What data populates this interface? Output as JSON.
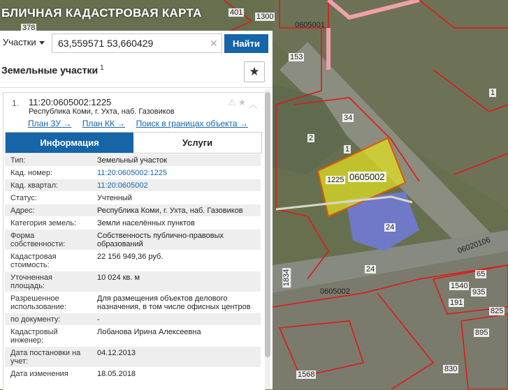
{
  "app": {
    "title": "ПУБЛИЧНАЯ КАДАСТРОВАЯ КАРТА",
    "visible_title": "БЛИЧНАЯ КАДАСТРОВАЯ КАРТА"
  },
  "search": {
    "type_label": "Участки",
    "query": "63,559571 53,660429",
    "clear": "✕",
    "button": "Найти"
  },
  "panel": {
    "title": "Земельные участки",
    "count_sup": "1",
    "star": "★"
  },
  "card": {
    "index": "1.",
    "cad_number": "11:20:0605002:1225",
    "address": "Республика Коми, г. Ухта, наб. Газовиков",
    "actions": [
      "⚠",
      "★",
      "︿"
    ],
    "links": [
      "План ЗУ →",
      "План КК →",
      "Поиск в границах объекта →"
    ],
    "tabs": [
      "Информация",
      "Услуги"
    ],
    "rows": [
      {
        "k": "Тип:",
        "v": "Земельный участок"
      },
      {
        "k": "Кад. номер:",
        "v": "11:20:0605002:1225",
        "link": true
      },
      {
        "k": "Кад. квартал:",
        "v": "11:20:0605002",
        "link": true
      },
      {
        "k": "Статус:",
        "v": "Учтенный"
      },
      {
        "k": "Адрес:",
        "v": "Республика Коми, г. Ухта, наб. Газовиков"
      },
      {
        "k": "Категория земель:",
        "v": "Земли населённых пунктов"
      },
      {
        "k": "Форма собственности:",
        "v": "Собственность публично-правовых образований"
      },
      {
        "k": "Кадастровая стоимость:",
        "v": "22 156 949,36 руб."
      },
      {
        "k": "Уточненная площадь:",
        "v": "10 024 кв. м"
      },
      {
        "k": "Разрешенное использование:",
        "v": "Для размещения объектов делового назначения, в том числе офисных центров"
      },
      {
        "k": "по документу:",
        "v": "-"
      },
      {
        "k": "Кадастровый инженер:",
        "v": "Лобанова Ирина Алексеевна"
      },
      {
        "k": "Дата постановки на учет:",
        "v": "04.12.2013"
      },
      {
        "k": "Дата изменения",
        "v": "18.05.2018"
      }
    ]
  },
  "map_labels": [
    "378",
    "401",
    "1300",
    "0605001",
    "153",
    "34",
    "2",
    "1",
    "1225",
    "0605002",
    "24",
    "1834",
    "0605002",
    "24",
    "06020106",
    "1540",
    "65",
    "935",
    "191",
    "825",
    "895",
    "830",
    "1568",
    "1"
  ],
  "colors": {
    "accent": "#1565a8",
    "parcel_fill": "#e6e61e",
    "boundary": "#e01818"
  }
}
